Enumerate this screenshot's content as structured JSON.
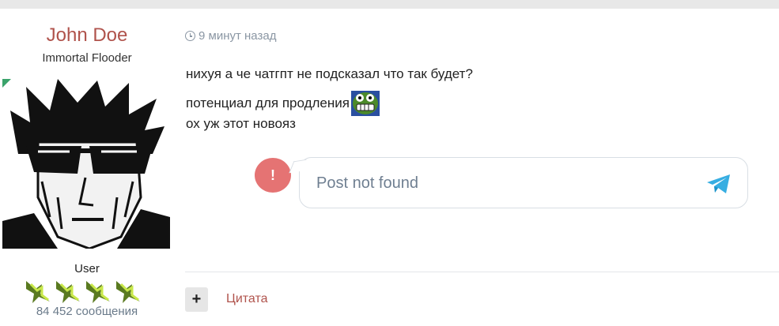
{
  "user": {
    "name": "John Doe",
    "title": "Immortal Flooder",
    "rank": "User",
    "message_count": "84 452 сообщения",
    "rank_stars": 4,
    "online_indicator_color": "#3aa36b"
  },
  "post": {
    "time": "9 минут назад",
    "lines": [
      "нихуя а че чатгпт не подсказал что так будет?",
      "потенциал для продления",
      "ох уж этот новояз"
    ],
    "emoji_icon": "grinning-frog-emoji"
  },
  "embed": {
    "message": "Post not found",
    "alert_symbol": "!",
    "alert_color": "#e57373",
    "send_icon": "telegram-icon"
  },
  "actions": {
    "plus_label": "+",
    "quote_label": "Цитата"
  }
}
